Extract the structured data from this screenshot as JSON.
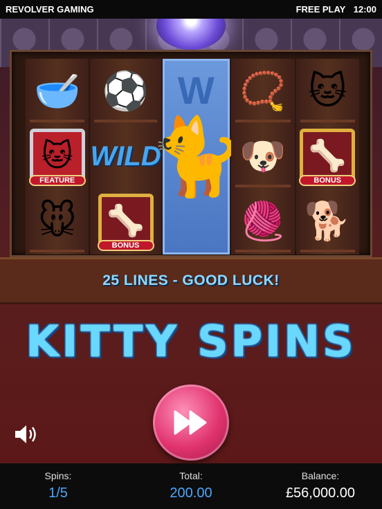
{
  "topbar": {
    "brand": "REVOLVER GAMING",
    "mode": "FREE PLAY",
    "clock": "12:00"
  },
  "reels": {
    "reel1": [
      {
        "icon": "food-bowl-icon",
        "glyph": "🥣"
      },
      {
        "icon": "kitten-feature-icon",
        "glyph": "🐱",
        "label": "FEATURE"
      },
      {
        "icon": "toy-mouse-icon",
        "glyph": "🐭"
      }
    ],
    "reel2": [
      {
        "icon": "beach-ball-icon",
        "glyph": "⚽"
      },
      {
        "icon": "wild-text",
        "label": "WILD"
      },
      {
        "icon": "bone-bonus-icon",
        "glyph": "🦴",
        "label": "BONUS"
      }
    ],
    "reel3": {
      "icon": "expanded-wild-kitten-icon",
      "glyph": "🐈",
      "label": "W"
    },
    "reel4": [
      {
        "icon": "pet-collar-icon",
        "glyph": "📿"
      },
      {
        "icon": "chihuahua-icon",
        "glyph": "🐶"
      },
      {
        "icon": "yarn-ball-icon",
        "glyph": "🧶"
      }
    ],
    "reel5": [
      {
        "icon": "orange-kitten-icon",
        "glyph": "🐱"
      },
      {
        "icon": "bone-bonus-icon",
        "glyph": "🦴",
        "label": "BONUS"
      },
      {
        "icon": "puppy-icon",
        "glyph": "🐕"
      }
    ]
  },
  "banner": {
    "message": "25 LINES - GOOD LUCK!"
  },
  "game": {
    "title": "KITTY SPINS"
  },
  "controls": {
    "spin_icon": "fast-forward-icon",
    "sound_icon": "speaker-icon"
  },
  "stats": {
    "spins_label": "Spins:",
    "spins_value": "1/5",
    "total_label": "Total:",
    "total_value": "200.00",
    "balance_label": "Balance:",
    "balance_value": "£56,000.00"
  },
  "colors": {
    "accent": "#4aa8ff",
    "spin_button": "#e0336e",
    "title": "#68d8ff"
  }
}
